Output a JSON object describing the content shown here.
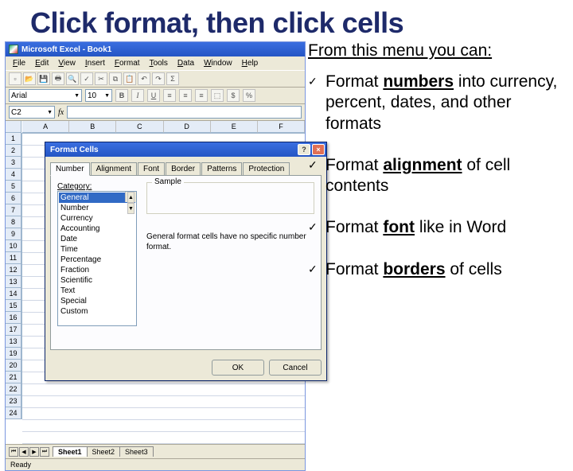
{
  "title": "Click format, then click cells",
  "subhead": "From this menu you can:",
  "bullets": [
    {
      "pre": "Format ",
      "u": "numbers",
      "post": " into currency, percent, dates, and other formats"
    },
    {
      "pre": "Format ",
      "u": "alignment",
      "post": " of cell contents"
    },
    {
      "pre": "Format ",
      "u": "font",
      "post": " like in Word"
    },
    {
      "pre": "Format ",
      "u": "borders",
      "post": " of cells"
    }
  ],
  "excel": {
    "app_title": "Microsoft Excel - Book1",
    "menus": [
      "File",
      "Edit",
      "View",
      "Insert",
      "Format",
      "Tools",
      "Data",
      "Window",
      "Help"
    ],
    "font_name": "Arial",
    "font_size": "10",
    "style_btns": [
      "B",
      "I",
      "U"
    ],
    "namebox": "C2",
    "fx": "fx",
    "columns": [
      "A",
      "B",
      "C",
      "D",
      "E",
      "F"
    ],
    "rows": [
      "1",
      "2",
      "3",
      "4",
      "5",
      "6",
      "7",
      "8",
      "9",
      "10",
      "11",
      "12",
      "13",
      "14",
      "15",
      "16",
      "17",
      "13",
      "19",
      "20",
      "21",
      "22",
      "23",
      "24"
    ],
    "sheets": [
      "Sheet1",
      "Sheet2",
      "Sheet3"
    ],
    "ready": "Ready"
  },
  "dialog": {
    "title": "Format Cells",
    "tabs": [
      "Number",
      "Alignment",
      "Font",
      "Border",
      "Patterns",
      "Protection"
    ],
    "category_label": "Category:",
    "sample_label": "Sample",
    "categories": [
      "General",
      "Number",
      "Currency",
      "Accounting",
      "Date",
      "Time",
      "Percentage",
      "Fraction",
      "Scientific",
      "Text",
      "Special",
      "Custom"
    ],
    "desc": "General format cells have no specific number format.",
    "ok": "OK",
    "cancel": "Cancel",
    "help_tip": "?",
    "close_tip": "×"
  }
}
